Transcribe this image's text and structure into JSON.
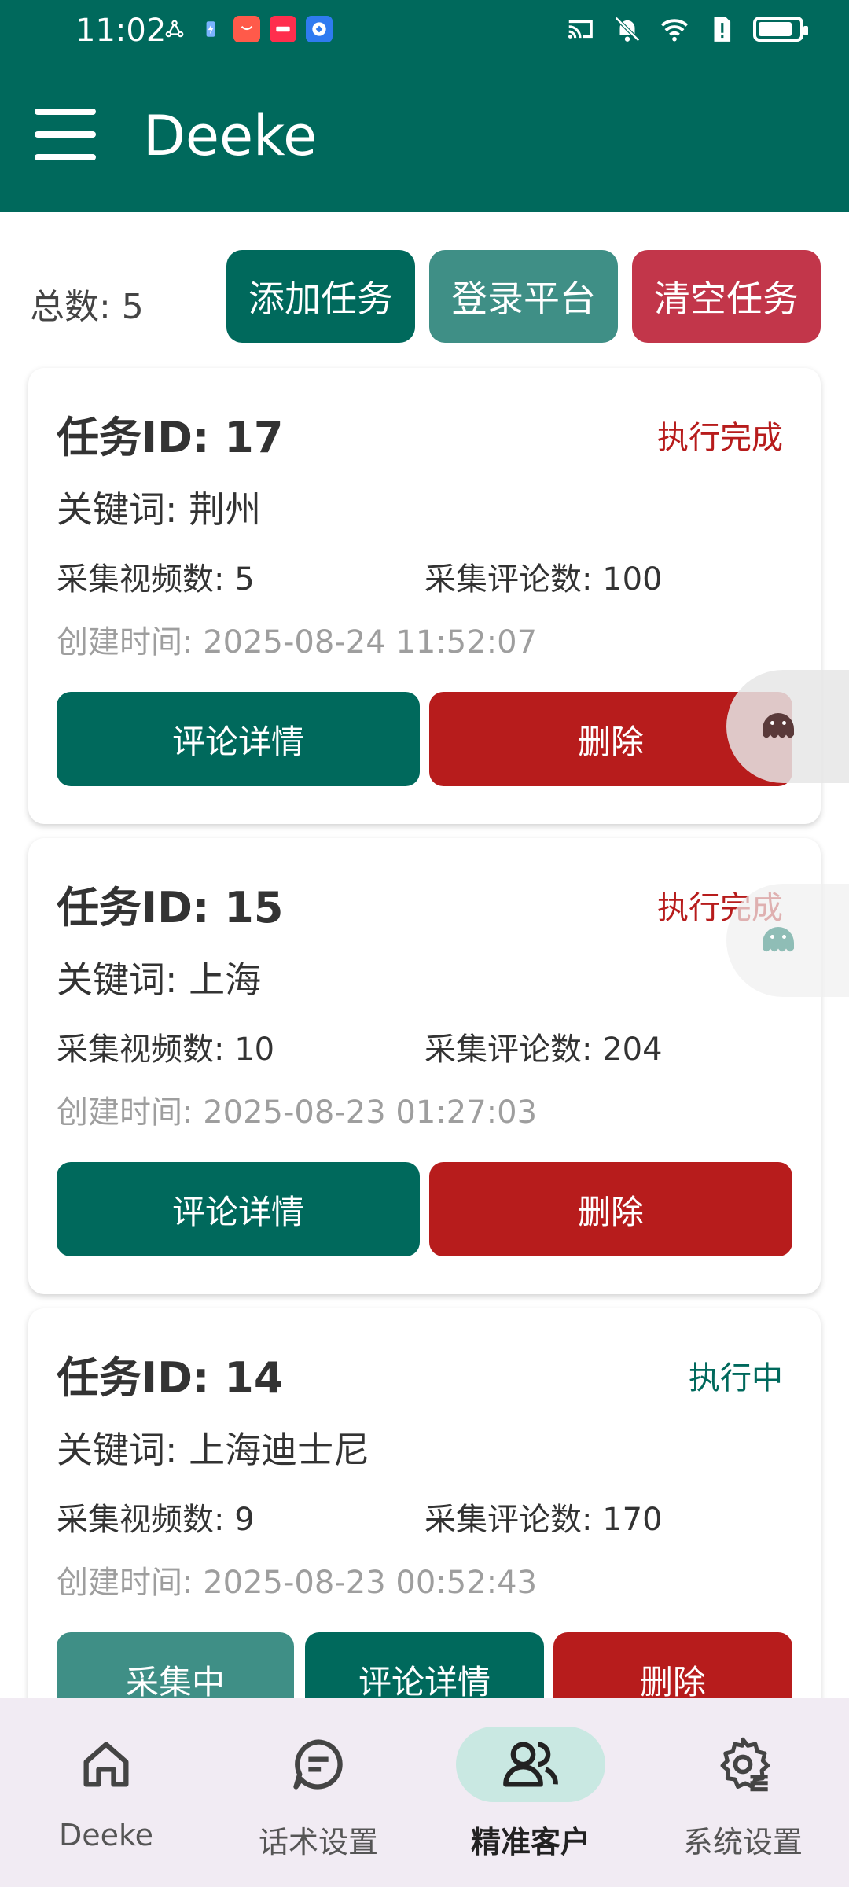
{
  "status_bar": {
    "time": "11:02",
    "battery_level": 0.85
  },
  "app_bar": {
    "title": "Deeke"
  },
  "toolbar": {
    "total_label": "总数: 5",
    "add_task": "添加任务",
    "login_platform": "登录平台",
    "clear_tasks": "清空任务"
  },
  "tasks": [
    {
      "title": "任务ID: 17",
      "status": "执行完成",
      "keyword": "关键词: 荆州",
      "videos": "采集视频数: 5",
      "comments": "采集评论数: 100",
      "created": "创建时间: 2025-08-24 11:52:07",
      "detail_btn": "评论详情",
      "delete_btn": "删除"
    },
    {
      "title": "任务ID: 15",
      "status": "执行完成",
      "keyword": "关键词: 上海",
      "videos": "采集视频数: 10",
      "comments": "采集评论数: 204",
      "created": "创建时间: 2025-08-23 01:27:03",
      "detail_btn": "评论详情",
      "delete_btn": "删除"
    },
    {
      "title": "任务ID: 14",
      "status": "执行中",
      "keyword": "关键词: 上海迪士尼",
      "videos": "采集视频数: 9",
      "comments": "采集评论数: 170",
      "created": "创建时间: 2025-08-23 00:52:43",
      "collecting_btn": "采集中",
      "detail_btn": "评论详情",
      "delete_btn": "删除"
    }
  ],
  "bottom_nav": {
    "items": [
      {
        "label": "Deeke",
        "icon": "home-icon"
      },
      {
        "label": "话术设置",
        "icon": "chat-icon"
      },
      {
        "label": "精准客户",
        "icon": "users-icon"
      },
      {
        "label": "系统设置",
        "icon": "settings-icon"
      }
    ],
    "active_index": 2
  },
  "colors": {
    "primary": "#00695c",
    "danger": "#b71c1c",
    "clear": "#c2364a",
    "secondary": "#3f8f86"
  }
}
